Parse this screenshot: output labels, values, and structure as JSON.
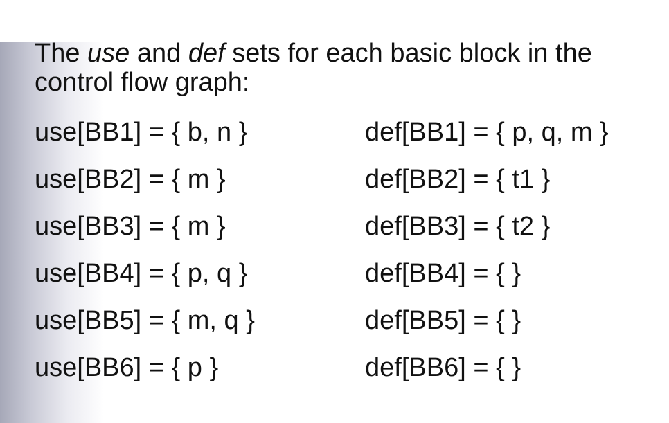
{
  "heading": {
    "prefix": "The ",
    "use_word": "use",
    "middle": " and ",
    "def_word": "def",
    "suffix": " sets for each basic block in the control flow graph:"
  },
  "rows": [
    {
      "use": "use[BB1] = { b, n }",
      "def": "def[BB1] = { p, q, m }"
    },
    {
      "use": "use[BB2] = { m }",
      "def": "def[BB2] = { t1 }"
    },
    {
      "use": "use[BB3] = { m }",
      "def": "def[BB3] = { t2 }"
    },
    {
      "use": "use[BB4] = { p, q }",
      "def": "def[BB4] = { }"
    },
    {
      "use": "use[BB5] = { m, q }",
      "def": "def[BB5] = { }"
    },
    {
      "use": "use[BB6] = { p }",
      "def": "def[BB6] = { }"
    }
  ]
}
